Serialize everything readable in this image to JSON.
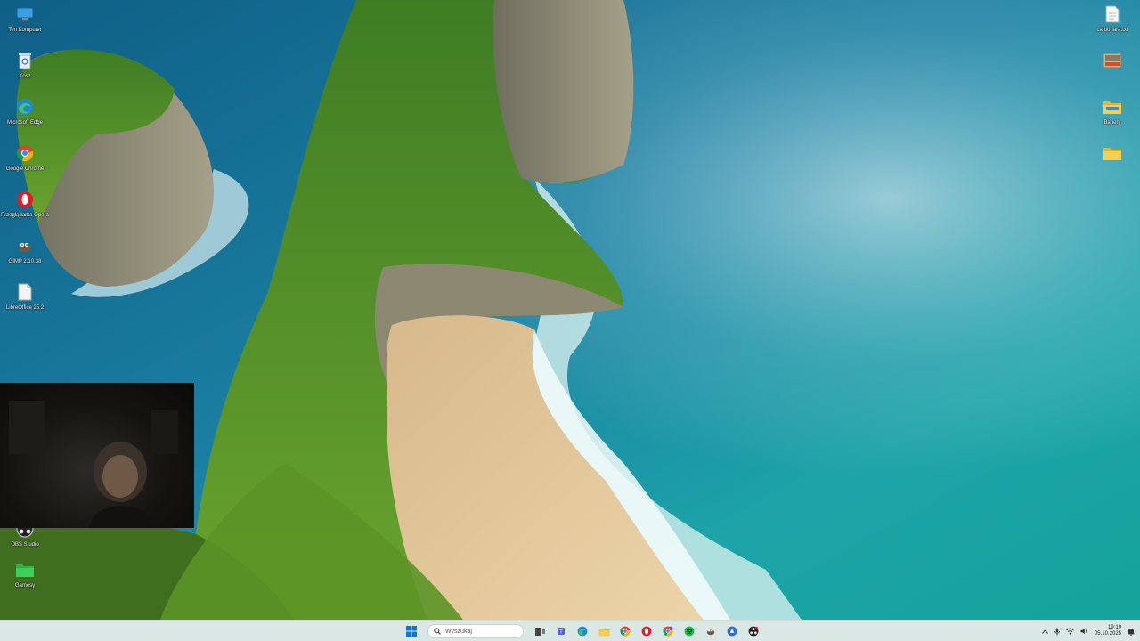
{
  "desktop": {
    "left_icons": [
      {
        "label": "Ten Komputer",
        "icon": "monitor-icon"
      },
      {
        "label": "Kosz",
        "icon": "recycle-bin-icon"
      },
      {
        "label": "Microsoft Edge",
        "icon": "edge-icon"
      },
      {
        "label": "Google Chrome",
        "icon": "chrome-icon"
      },
      {
        "label": "Przeglądarka Opera",
        "icon": "opera-icon"
      },
      {
        "label": "GIMP 2.10.38",
        "icon": "gimp-icon"
      },
      {
        "label": "LibreOffice 25.2",
        "icon": "document-icon"
      },
      {
        "label": "OBS Studio",
        "icon": "obs-icon"
      },
      {
        "label": "Gamesy",
        "icon": "folder-icon"
      }
    ],
    "right_icons": [
      {
        "label": "carbonara.txt",
        "icon": "text-file-icon"
      },
      {
        "label": "",
        "icon": "image-file-icon"
      },
      {
        "label": "Banery",
        "icon": "folder-icon"
      },
      {
        "label": "",
        "icon": "folder-icon"
      }
    ]
  },
  "taskbar": {
    "search_placeholder": "Wyszukaj",
    "pinned": [
      {
        "name": "task-view",
        "icon": "task-view-icon"
      },
      {
        "name": "teams",
        "icon": "teams-icon"
      },
      {
        "name": "edge",
        "icon": "edge-icon"
      },
      {
        "name": "file-explorer",
        "icon": "folder-icon"
      },
      {
        "name": "chrome",
        "icon": "chrome-icon"
      },
      {
        "name": "opera",
        "icon": "opera-icon"
      },
      {
        "name": "chrome-profile",
        "icon": "chrome-icon"
      },
      {
        "name": "spotify",
        "icon": "spotify-icon"
      },
      {
        "name": "gimp",
        "icon": "gimp-icon"
      },
      {
        "name": "app-blue",
        "icon": "app-icon"
      },
      {
        "name": "obs",
        "icon": "obs-icon"
      }
    ],
    "clock": {
      "time": "19:19",
      "date": "05.10.2025"
    }
  },
  "colors": {
    "sea": "#1d8fa0",
    "cliff_green": "#4f8a2a",
    "sand": "#e2c596",
    "taskbar": "#ebf0eb",
    "windows_blue": "#0a7bd4"
  }
}
